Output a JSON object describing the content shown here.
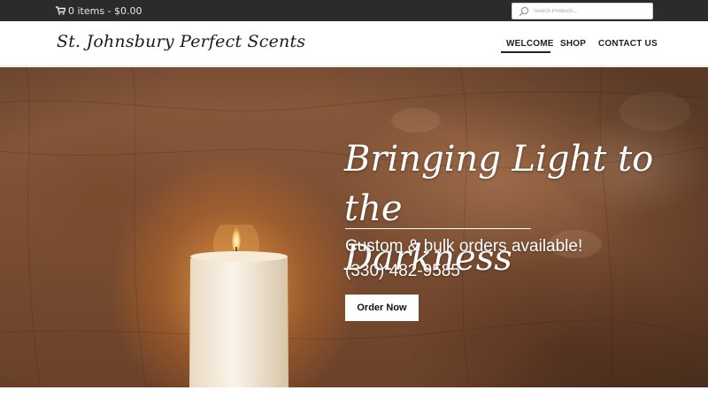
{
  "topbar": {
    "cart_icon": "cart-icon",
    "cart_text": "0 items - $0.00",
    "search_icon": "search-icon",
    "search_placeholder": "Search Products..."
  },
  "header": {
    "logo_text": "St. Johnsbury Perfect Scents",
    "nav": [
      {
        "label": "WELCOME",
        "active": true
      },
      {
        "label": "SHOP",
        "active": false
      },
      {
        "label": "CONTACT US",
        "active": false
      }
    ]
  },
  "hero": {
    "headline_line1": "Bringing Light to the",
    "headline_line2": "Darkness",
    "subline": "Custom & bulk orders available!",
    "phone": "(330) 482-9585",
    "cta_label": "Order Now",
    "image_subject": "lit white pillar candle on rustic brown textured background"
  },
  "colors": {
    "topbar_bg": "#2b2b2b",
    "header_bg": "#ffffff",
    "hero_bg": "#7d4f33",
    "text_light": "#ffffff",
    "text_dark": "#222222"
  }
}
